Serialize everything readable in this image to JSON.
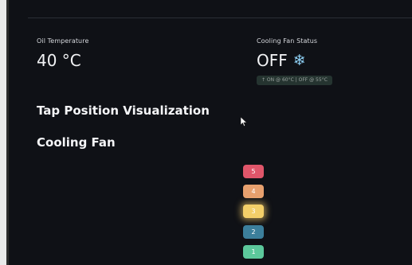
{
  "oil": {
    "label": "Oil Temperature",
    "value": "40 °C"
  },
  "fan_status": {
    "label": "Cooling Fan Status",
    "value": "OFF",
    "icon": "snowflake-icon",
    "delta": "↑ ON @ 60°C | OFF @ 55°C"
  },
  "headings": {
    "tap_position": "Tap Position Visualization",
    "cooling_fan": "Cooling Fan"
  },
  "taps": [
    {
      "label": "5",
      "color": "#e0566a",
      "active": false
    },
    {
      "label": "4",
      "color": "#e7a06e",
      "active": false
    },
    {
      "label": "3",
      "color": "#f3cf69",
      "active": true
    },
    {
      "label": "2",
      "color": "#3c7f9b",
      "active": false
    },
    {
      "label": "1",
      "color": "#5cc89b",
      "active": false
    }
  ],
  "colors": {
    "background": "#0f1116",
    "snowflake": "#8ed0f5"
  }
}
